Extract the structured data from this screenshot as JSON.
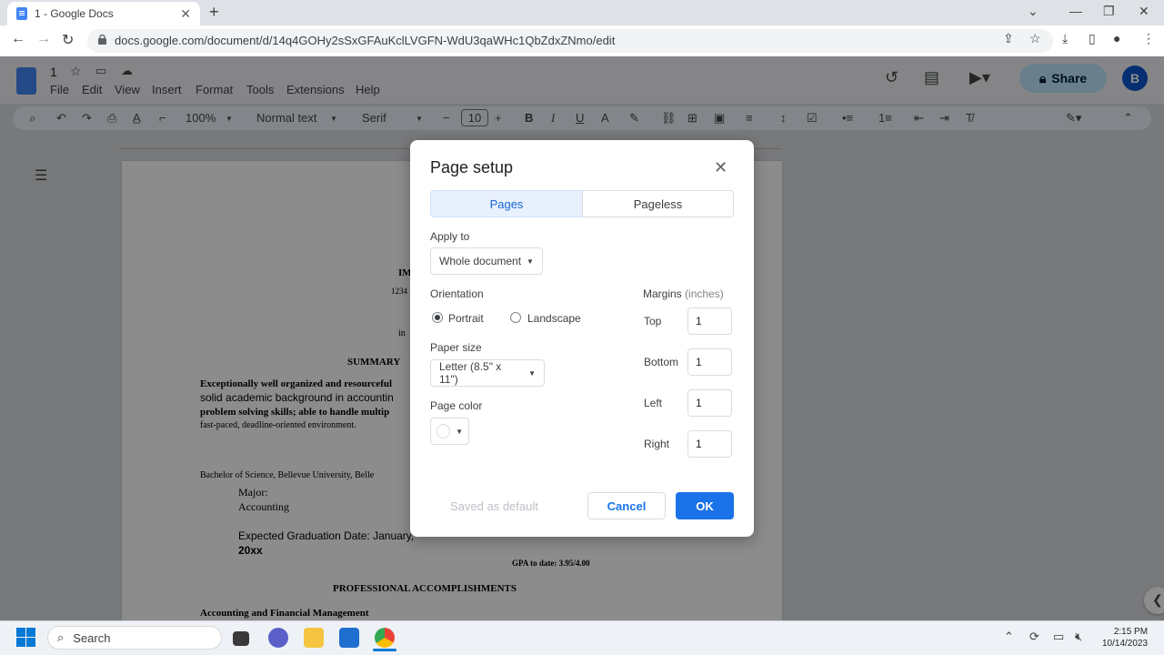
{
  "browser": {
    "tab_title": "1 - Google Docs",
    "url": "docs.google.com/document/d/14q4GOHy2sSxGFAuKclLVGFN-WdU3qaWHc1QbZdxZNmo/edit"
  },
  "docs": {
    "doc_name": "1",
    "menu": [
      "File",
      "Edit",
      "View",
      "Insert",
      "Format",
      "Tools",
      "Extensions",
      "Help"
    ],
    "share_label": "Share",
    "avatar_letter": "B",
    "toolbar": {
      "zoom": "100%",
      "style": "Normal text",
      "font": "Serif",
      "font_size": "10"
    }
  },
  "document": {
    "lines": [
      "IM",
      "1234",
      "in",
      "SUMMARY",
      "Exceptionally well organized and resourceful",
      "solid academic background in accountin",
      "problem solving skills; able to handle multip",
      "fast-paced, deadline-oriented environment.",
      "Bachelor of Science, Bellevue University, Belle",
      "Major:",
      "Accounting",
      "Expected Graduation Date: January,",
      "20xx",
      "GPA to date: 3.95/4.00",
      "PROFESSIONAL ACCOMPLISHMENTS",
      "Accounting and Financial Management"
    ]
  },
  "dialog": {
    "title": "Page setup",
    "tabs": [
      "Pages",
      "Pageless"
    ],
    "apply_to_label": "Apply to",
    "apply_to_value": "Whole document",
    "orientation_label": "Orientation",
    "orientation_options": [
      "Portrait",
      "Landscape"
    ],
    "orientation_selected": "Portrait",
    "paper_size_label": "Paper size",
    "paper_size_value": "Letter (8.5\" x 11\")",
    "page_color_label": "Page color",
    "page_color_value": "#ffffff",
    "margins_label": "Margins",
    "margins_unit": "(inches)",
    "margins": [
      {
        "label": "Top",
        "value": "1"
      },
      {
        "label": "Bottom",
        "value": "1"
      },
      {
        "label": "Left",
        "value": "1"
      },
      {
        "label": "Right",
        "value": "1"
      }
    ],
    "saved_default_label": "Saved as default",
    "cancel_label": "Cancel",
    "ok_label": "OK"
  },
  "taskbar": {
    "search_label": "Search",
    "time": "2:15 PM",
    "date": "10/14/2023"
  },
  "colors": {
    "accent": "#1a73e8",
    "share_bg": "#c2e7ff"
  }
}
